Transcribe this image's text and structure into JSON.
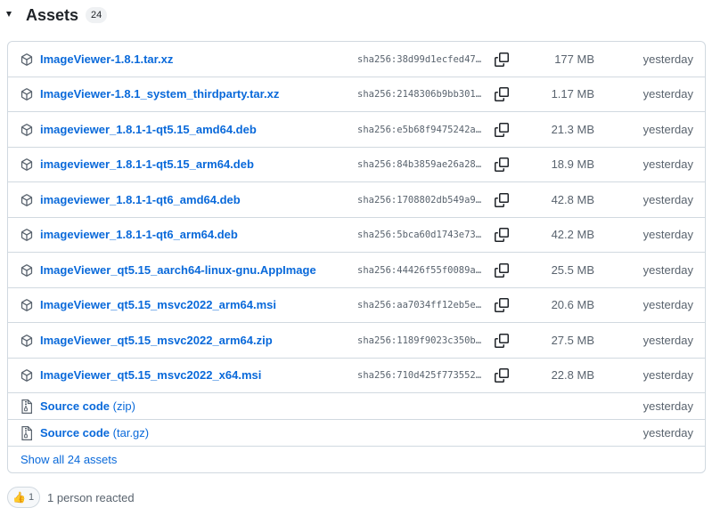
{
  "header": {
    "title": "Assets",
    "count": "24"
  },
  "assets": [
    {
      "name": "ImageViewer-1.8.1.tar.xz",
      "sha": "sha256:38d99d1ecfed47…",
      "size": "177 MB",
      "date": "yesterday"
    },
    {
      "name": "ImageViewer-1.8.1_system_thirdparty.tar.xz",
      "sha": "sha256:2148306b9bb301…",
      "size": "1.17 MB",
      "date": "yesterday"
    },
    {
      "name": "imageviewer_1.8.1-1-qt5.15_amd64.deb",
      "sha": "sha256:e5b68f9475242a…",
      "size": "21.3 MB",
      "date": "yesterday"
    },
    {
      "name": "imageviewer_1.8.1-1-qt5.15_arm64.deb",
      "sha": "sha256:84b3859ae26a28…",
      "size": "18.9 MB",
      "date": "yesterday"
    },
    {
      "name": "imageviewer_1.8.1-1-qt6_amd64.deb",
      "sha": "sha256:1708802db549a9…",
      "size": "42.8 MB",
      "date": "yesterday"
    },
    {
      "name": "imageviewer_1.8.1-1-qt6_arm64.deb",
      "sha": "sha256:5bca60d1743e73…",
      "size": "42.2 MB",
      "date": "yesterday"
    },
    {
      "name": "ImageViewer_qt5.15_aarch64-linux-gnu.AppImage",
      "sha": "sha256:44426f55f0089a…",
      "size": "25.5 MB",
      "date": "yesterday"
    },
    {
      "name": "ImageViewer_qt5.15_msvc2022_arm64.msi",
      "sha": "sha256:aa7034ff12eb5e…",
      "size": "20.6 MB",
      "date": "yesterday"
    },
    {
      "name": "ImageViewer_qt5.15_msvc2022_arm64.zip",
      "sha": "sha256:1189f9023c350b…",
      "size": "27.5 MB",
      "date": "yesterday"
    },
    {
      "name": "ImageViewer_qt5.15_msvc2022_x64.msi",
      "sha": "sha256:710d425f773552…",
      "size": "22.8 MB",
      "date": "yesterday"
    }
  ],
  "source": [
    {
      "label": "Source code",
      "format": "(zip)",
      "date": "yesterday"
    },
    {
      "label": "Source code",
      "format": "(tar.gz)",
      "date": "yesterday"
    }
  ],
  "show_all": "Show all 24 assets",
  "reactions": {
    "emoji": "👍",
    "count": "1",
    "summary": "1 person reacted"
  },
  "icons": {
    "asset": "package-icon",
    "source": "file-zip-icon",
    "copy": "copy-icon",
    "toggle": "triangle-down-icon"
  },
  "colors": {
    "link": "#0969da",
    "muted": "#59636e",
    "border": "#d1d9e0",
    "text": "#1f2328"
  }
}
